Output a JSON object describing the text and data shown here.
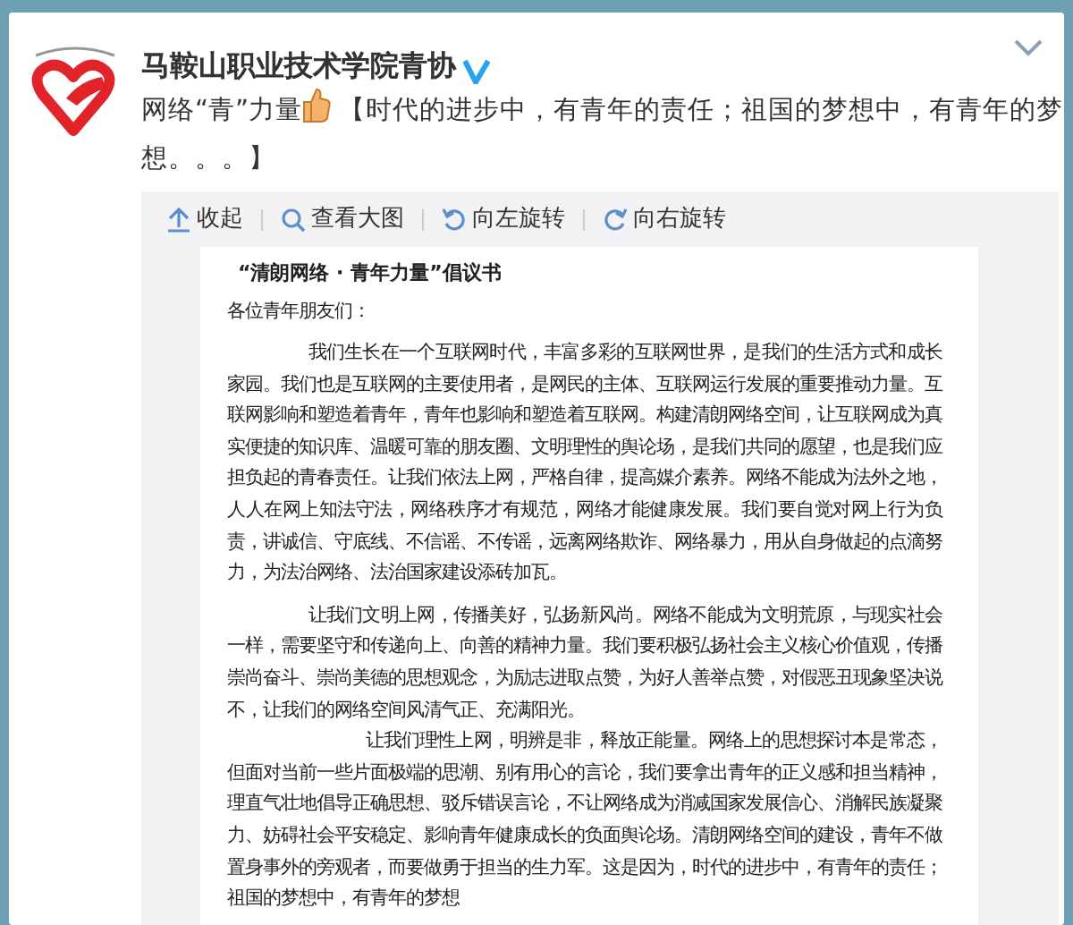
{
  "account": {
    "name": "马鞍山职业技术学院青协",
    "verified": true
  },
  "post": {
    "text_before": "网络“青”力量",
    "text_after": " 【时代的进步中，有青年的责任；祖国的梦想中，有青年的梦想。。。】"
  },
  "media_toolbar": [
    {
      "label": "收起",
      "kind": "collapse"
    },
    {
      "label": "查看大图",
      "kind": "zoom"
    },
    {
      "label": "向左旋转",
      "kind": "rotate_left"
    },
    {
      "label": "向右旋转",
      "kind": "rotate_right"
    }
  ],
  "document": {
    "title": "“清朗网络 · 青年力量”倡议书",
    "greeting": "各位青年朋友们：",
    "paragraphs": [
      {
        "text": "我们生长在一个互联网时代，丰富多彩的互联网世界，是我们的生活方式和成长家园。我们也是互联网的主要使用者，是网民的主体、互联网运行发展的重要推动力量。互联网影响和塑造着青年，青年也影响和塑造着互联网。构建清朗网络空间，让互联网成为真实便捷的知识库、温暖可靠的朋友圈、文明理性的舆论场，是我们共同的愿望，也是我们应担负起的青春责任。让我们依法上网，严格自律，提高媒介素养。网络不能成为法外之地，人人在网上知法守法，网络秩序才有规范，网络才能健康发展。我们要自觉对网上行为负责，讲诚信、守底线、不信谣、不传谣，远离网络欺诈、网络暴力，用从自身做起的点滴努力，为法治网络、法治国家建设添砖加瓦。",
        "run_in": false
      },
      {
        "text": "让我们文明上网，传播美好，弘扬新风尚。网络不能成为文明荒原，与现实社会一样，需要坚守和传递向上、向善的精神力量。我们要积极弘扬社会主义核心价值观，传播崇尚奋斗、崇尚美德的思想观念，为励志进取点赞，为好人善举点赞，对假恶丑现象坚决说不，让我们的网络空间风清气正、充满阳光。",
        "run_in": false
      },
      {
        "text": "让我们理性上网，明辨是非，释放正能量。网络上的思想探讨本是常态，但面对当前一些片面极端的思潮、别有用心的言论，我们要拿出青年的正义感和担当精神，理直气壮地倡导正确思想、驳斥错误言论，不让网络成为消减国家发展信心、消解民族凝聚力、妨碍社会平安稳定、影响青年健康成长的负面舆论场。清朗网络空间的建设，青年不做置身事外的旁观者，而要做勇于担当的生力军。这是因为，时代的进步中，有青年的责任；祖国的梦想中，有青年的梦想",
        "run_in": true
      }
    ]
  }
}
